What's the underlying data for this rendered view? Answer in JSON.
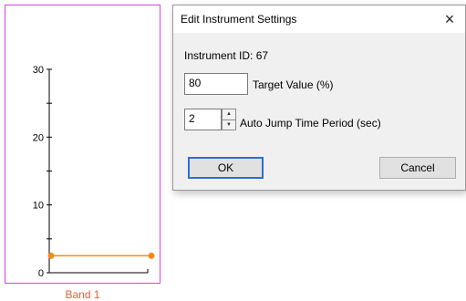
{
  "chart": {
    "caption": "Band 1",
    "y_ticks": [
      "0",
      "10",
      "20",
      "30"
    ],
    "series_color": "#f28a1a",
    "frame_color": "#e040e0"
  },
  "chart_data": {
    "type": "line",
    "x": [
      0,
      1
    ],
    "series": [
      {
        "values": [
          2.5,
          2.5
        ]
      }
    ],
    "ylim": [
      0,
      30
    ],
    "title": "",
    "xlabel": "Band 1",
    "ylabel": ""
  },
  "dialog": {
    "title": "Edit Instrument Settings",
    "close_icon": "×",
    "instrument_id": "Instrument ID: 67",
    "target_value": "80",
    "target_label": "Target Value (%)",
    "jump_value": "2",
    "jump_label": "Auto Jump Time Period (sec)",
    "ok_label": "OK",
    "cancel_label": "Cancel",
    "spin_up_icon": "▲",
    "spin_down_icon": "▼"
  }
}
